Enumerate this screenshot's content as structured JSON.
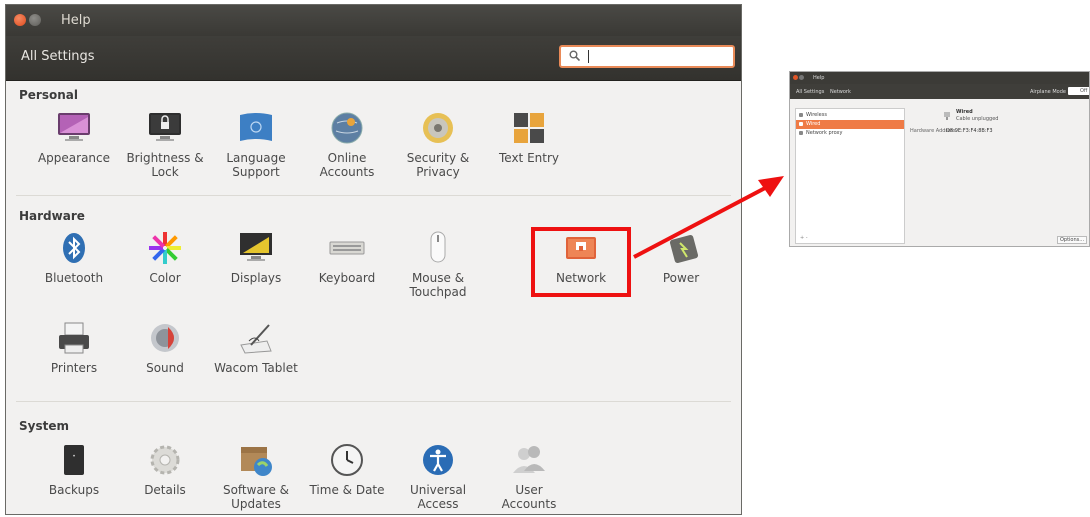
{
  "window": {
    "title": "Help",
    "all_settings": "All Settings",
    "search_value": ""
  },
  "sections": {
    "personal": {
      "heading": "Personal",
      "items": [
        {
          "line1": "Appearance",
          "line2": "",
          "icon": "appearance-icon"
        },
        {
          "line1": "Brightness &",
          "line2": "Lock",
          "icon": "brightness-lock-icon"
        },
        {
          "line1": "Language",
          "line2": "Support",
          "icon": "language-support-icon"
        },
        {
          "line1": "Online",
          "line2": "Accounts",
          "icon": "online-accounts-icon"
        },
        {
          "line1": "Security &",
          "line2": "Privacy",
          "icon": "security-privacy-icon"
        },
        {
          "line1": "Text Entry",
          "line2": "",
          "icon": "text-entry-icon"
        }
      ]
    },
    "hardware": {
      "heading": "Hardware",
      "items": [
        {
          "line1": "Bluetooth",
          "line2": "",
          "icon": "bluetooth-icon"
        },
        {
          "line1": "Color",
          "line2": "",
          "icon": "color-icon"
        },
        {
          "line1": "Displays",
          "line2": "",
          "icon": "displays-icon"
        },
        {
          "line1": "Keyboard",
          "line2": "",
          "icon": "keyboard-icon"
        },
        {
          "line1": "Mouse &",
          "line2": "Touchpad",
          "icon": "mouse-icon"
        },
        {
          "line1": "Network",
          "line2": "",
          "icon": "network-icon"
        },
        {
          "line1": "Power",
          "line2": "",
          "icon": "power-icon"
        },
        {
          "line1": "Printers",
          "line2": "",
          "icon": "printer-icon"
        },
        {
          "line1": "Sound",
          "line2": "",
          "icon": "sound-icon"
        },
        {
          "line1": "Wacom Tablet",
          "line2": "",
          "icon": "wacom-tablet-icon"
        }
      ]
    },
    "system": {
      "heading": "System",
      "items": [
        {
          "line1": "Backups",
          "line2": "",
          "icon": "backups-icon"
        },
        {
          "line1": "Details",
          "line2": "",
          "icon": "details-icon"
        },
        {
          "line1": "Software &",
          "line2": "Updates",
          "icon": "software-updates-icon"
        },
        {
          "line1": "Time & Date",
          "line2": "",
          "icon": "clock-icon"
        },
        {
          "line1": "Universal",
          "line2": "Access",
          "icon": "universal-access-icon"
        },
        {
          "line1": "User",
          "line2": "Accounts",
          "icon": "user-accounts-icon"
        }
      ]
    }
  },
  "network_window": {
    "title": "Help",
    "all_settings": "All Settings",
    "network_button": "Network",
    "airplane_mode": "Airplane Mode",
    "airplane_toggle": "Off",
    "list": [
      "Wireless",
      "Wired",
      "Network proxy"
    ],
    "wired_title": "Wired",
    "wired_status": "Cable unplugged",
    "hw_label": "Hardware Address",
    "hw_value": "D8:9E:F3:F4:8B:F3",
    "options": "Options...",
    "add_remove": "+ -"
  },
  "colors": {
    "accent": "#e98a58",
    "highlight": "#ee1111",
    "selected_row": "#ef7b46"
  }
}
